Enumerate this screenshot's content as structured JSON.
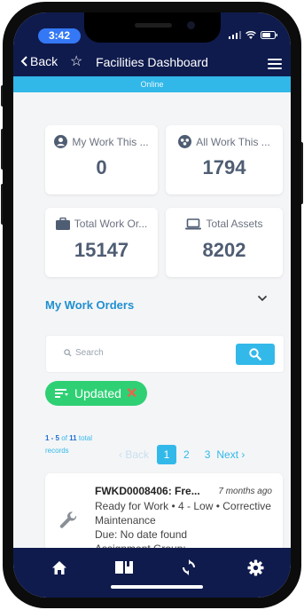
{
  "status_bar": {
    "time": "3:42"
  },
  "nav": {
    "back_label": "Back",
    "title": "Facilities Dashboard"
  },
  "connection": {
    "status": "Online"
  },
  "stats": [
    {
      "label": "My Work This ...",
      "value": "0",
      "icon": "user-circle-icon"
    },
    {
      "label": "All Work This ...",
      "value": "1794",
      "icon": "group-icon"
    },
    {
      "label": "Total Work Or...",
      "value": "15147",
      "icon": "briefcase-icon"
    },
    {
      "label": "Total Assets",
      "value": "8202",
      "icon": "laptop-icon"
    }
  ],
  "work_orders": {
    "section_title": "My Work Orders",
    "search_placeholder": "Search",
    "filter_chip": "Updated",
    "range": "1 - 5",
    "of_word": "of",
    "total": "11",
    "total_suffix": "total",
    "records_word": "records",
    "pager": {
      "back": "‹ Back",
      "pages": [
        "1",
        "2",
        "3"
      ],
      "next": "Next ›",
      "current": "1"
    },
    "item": {
      "id_title": "FWKD0008406: Fre...",
      "age": "7 months ago",
      "line1": "Ready for Work • 4 - Low • Corrective",
      "line2": "Maintenance",
      "line3": "Due: No date found",
      "line4": "Assignment Group:"
    }
  },
  "colors": {
    "navy": "#0f1b4d",
    "accent": "#33b9e9",
    "link": "#1f8fd0",
    "chip_green": "#2fd074",
    "stat_number": "#4f5d73"
  },
  "tabbar_icons": [
    "home-icon",
    "book-icon",
    "sync-icon",
    "gear-icon"
  ]
}
